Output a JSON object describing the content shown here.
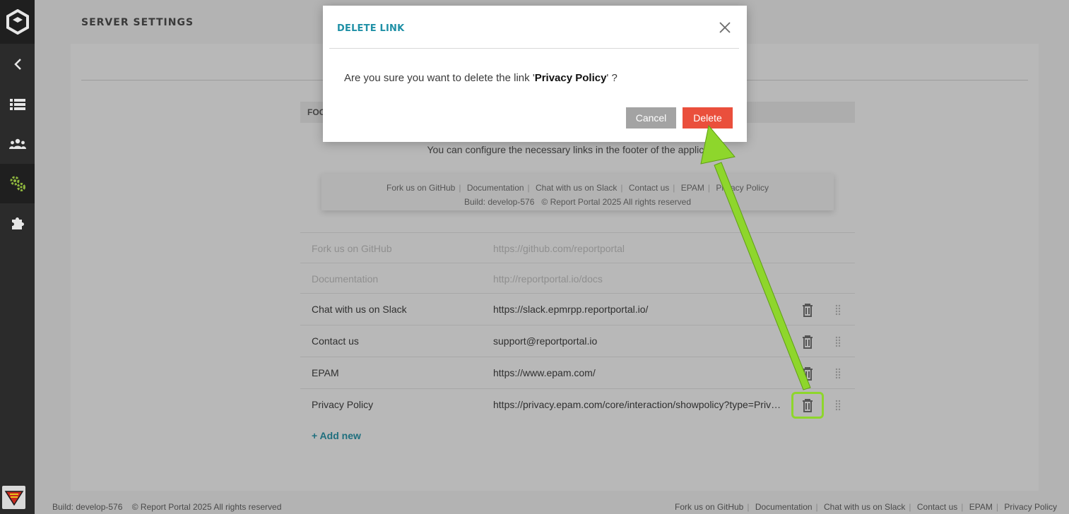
{
  "page": {
    "title": "SERVER SETTINGS"
  },
  "sidebar": {
    "items": [
      {
        "name": "back",
        "icon": "chevron-left-icon"
      },
      {
        "name": "launches",
        "icon": "list-icon"
      },
      {
        "name": "members",
        "icon": "users-icon"
      },
      {
        "name": "settings",
        "icon": "gears-icon",
        "active": true
      },
      {
        "name": "plugins",
        "icon": "puzzle-icon"
      }
    ],
    "active_color": "#8fb73e"
  },
  "footer_settings": {
    "section_head": "FOOTER",
    "description": "You can configure the necessary links in the footer of the application.",
    "preview": {
      "links": [
        "Fork us on GitHub",
        "Documentation",
        "Chat with us on Slack",
        "Contact us",
        "EPAM",
        "Privacy Policy"
      ],
      "build": "Build: develop-576",
      "copyright": "© Report Portal 2025 All rights reserved"
    },
    "links": [
      {
        "name": "Fork us on GitHub",
        "url": "https://github.com/reportportal",
        "editable": false
      },
      {
        "name": "Documentation",
        "url": "http://reportportal.io/docs",
        "editable": false
      },
      {
        "name": "Chat with us on Slack",
        "url": "https://slack.epmrpp.reportportal.io/",
        "editable": true
      },
      {
        "name": "Contact us",
        "url": "support@reportportal.io",
        "editable": true
      },
      {
        "name": "EPAM",
        "url": "https://www.epam.com/",
        "editable": true
      },
      {
        "name": "Privacy Policy",
        "url": "https://privacy.epam.com/core/interaction/showpolicy?type=Priva...",
        "editable": true
      }
    ],
    "add_new": "+ Add new"
  },
  "page_footer": {
    "build": "Build: develop-576",
    "copyright": "© Report Portal 2025 All rights reserved",
    "links": [
      "Fork us on GitHub",
      "Documentation",
      "Chat with us on Slack",
      "Contact us",
      "EPAM",
      "Privacy Policy"
    ]
  },
  "modal": {
    "title": "DELETE LINK",
    "message_prefix": "Are you sure you want to delete the link '",
    "message_link": "Privacy Policy",
    "message_suffix": "' ?",
    "cancel_label": "Cancel",
    "delete_label": "Delete",
    "delete_color": "#ea4f3c",
    "title_color": "#1f90a6"
  },
  "annotation": {
    "color": "#8ed62c"
  }
}
